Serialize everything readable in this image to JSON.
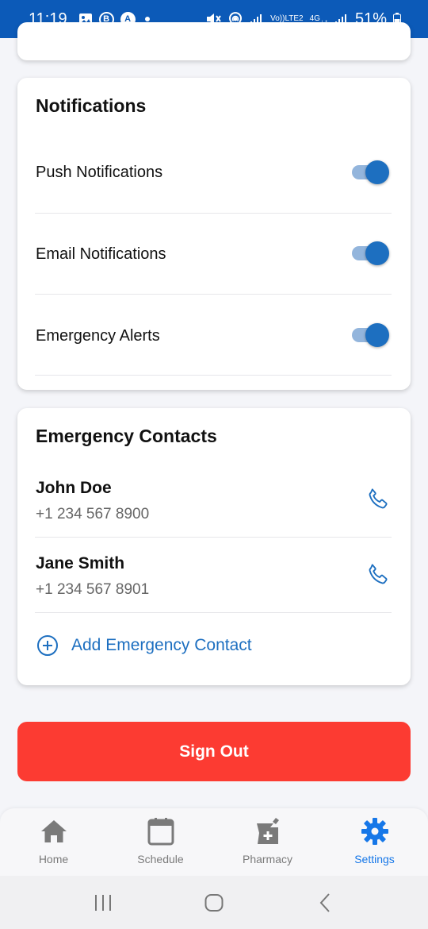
{
  "status_bar": {
    "time": "11:19",
    "badge_b": "B",
    "badge_a": "A",
    "volte": "Vo))",
    "lte": "LTE2",
    "network": "4G",
    "battery": "51%"
  },
  "notifications": {
    "title": "Notifications",
    "items": [
      {
        "label": "Push Notifications",
        "enabled": true
      },
      {
        "label": "Email Notifications",
        "enabled": true
      },
      {
        "label": "Emergency Alerts",
        "enabled": true
      }
    ]
  },
  "emergency_contacts": {
    "title": "Emergency Contacts",
    "contacts": [
      {
        "name": "John Doe",
        "phone": "+1 234 567 8900"
      },
      {
        "name": "Jane Smith",
        "phone": "+1 234 567 8901"
      }
    ],
    "add_label": "Add Emergency Contact"
  },
  "sign_out_label": "Sign Out",
  "tabs": [
    {
      "label": "Home",
      "icon": "home-icon",
      "active": false
    },
    {
      "label": "Schedule",
      "icon": "calendar-icon",
      "active": false
    },
    {
      "label": "Pharmacy",
      "icon": "pharmacy-icon",
      "active": false
    },
    {
      "label": "Settings",
      "icon": "gear-icon",
      "active": true
    }
  ],
  "colors": {
    "accent": "#1677e8",
    "toggle_on": "#1d6fc0",
    "danger": "#fc3b32",
    "status_bar": "#0c5ab8"
  }
}
